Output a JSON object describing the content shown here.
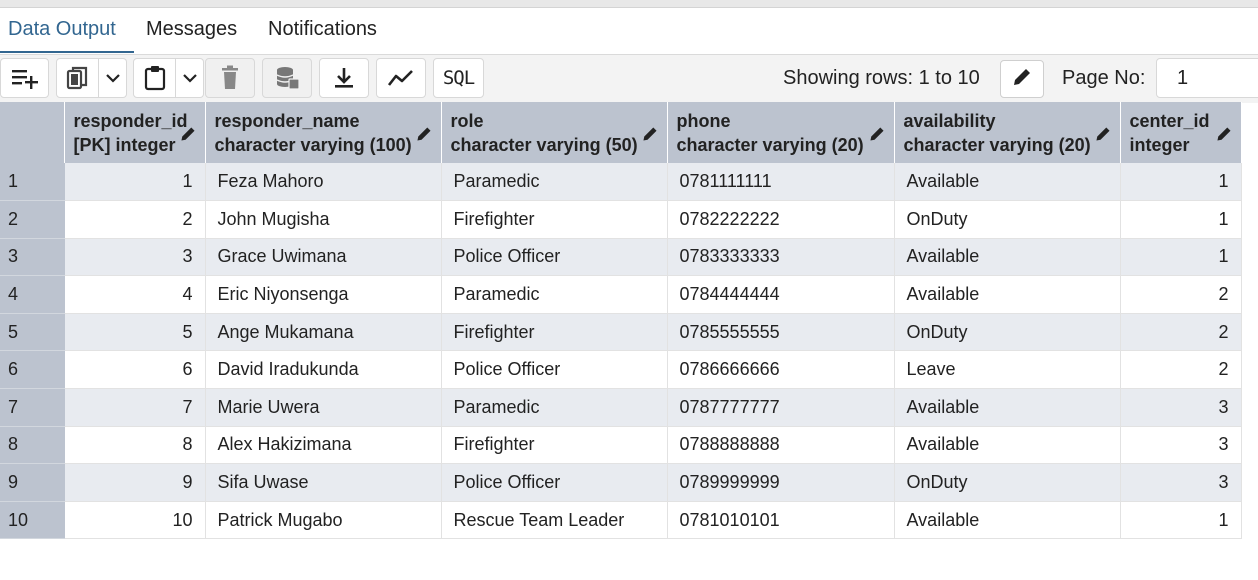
{
  "tabs": [
    {
      "label": "Data Output",
      "active": true
    },
    {
      "label": "Messages",
      "active": false
    },
    {
      "label": "Notifications",
      "active": false
    }
  ],
  "toolbar": {
    "buttons": [
      {
        "name": "add-row-icon"
      },
      {
        "name": "copy-icon"
      },
      {
        "name": "chevron-down-icon"
      },
      {
        "name": "paste-icon"
      },
      {
        "name": "chevron-down-icon"
      },
      {
        "name": "delete-icon"
      },
      {
        "name": "save-data-icon"
      },
      {
        "name": "download-icon"
      },
      {
        "name": "graph-icon"
      },
      {
        "name": "sql-icon"
      }
    ],
    "sql_label": "SQL",
    "rows_info": "Showing rows: 1 to 10",
    "page_label": "Page No:",
    "page_value": "1"
  },
  "grid": {
    "columns": [
      {
        "name": "responder_id",
        "type": "[PK] integer"
      },
      {
        "name": "responder_name",
        "type": "character varying (100)"
      },
      {
        "name": "role",
        "type": "character varying (50)"
      },
      {
        "name": "phone",
        "type": "character varying (20)"
      },
      {
        "name": "availability",
        "type": "character varying (20)"
      },
      {
        "name": "center_id",
        "type": "integer"
      }
    ],
    "rows": [
      {
        "n": "1",
        "cells": [
          "1",
          "Feza Mahoro",
          "Paramedic",
          "0781111111",
          "Available",
          "1"
        ]
      },
      {
        "n": "2",
        "cells": [
          "2",
          "John Mugisha",
          "Firefighter",
          "0782222222",
          "OnDuty",
          "1"
        ]
      },
      {
        "n": "3",
        "cells": [
          "3",
          "Grace Uwimana",
          "Police Officer",
          "0783333333",
          "Available",
          "1"
        ]
      },
      {
        "n": "4",
        "cells": [
          "4",
          "Eric Niyonsenga",
          "Paramedic",
          "0784444444",
          "Available",
          "2"
        ]
      },
      {
        "n": "5",
        "cells": [
          "5",
          "Ange Mukamana",
          "Firefighter",
          "0785555555",
          "OnDuty",
          "2"
        ]
      },
      {
        "n": "6",
        "cells": [
          "6",
          "David Iradukunda",
          "Police Officer",
          "0786666666",
          "Leave",
          "2"
        ]
      },
      {
        "n": "7",
        "cells": [
          "7",
          "Marie Uwera",
          "Paramedic",
          "0787777777",
          "Available",
          "3"
        ]
      },
      {
        "n": "8",
        "cells": [
          "8",
          "Alex Hakizimana",
          "Firefighter",
          "0788888888",
          "Available",
          "3"
        ]
      },
      {
        "n": "9",
        "cells": [
          "9",
          "Sifa Uwase",
          "Police Officer",
          "0789999999",
          "OnDuty",
          "3"
        ]
      },
      {
        "n": "10",
        "cells": [
          "10",
          "Patrick Mugabo",
          "Rescue Team Leader",
          "0781010101",
          "Available",
          "1"
        ]
      }
    ]
  },
  "colors": {
    "accent": "#326690",
    "header_bg": "#bcc3cf",
    "row_alt_bg": "#e8ebf0"
  }
}
